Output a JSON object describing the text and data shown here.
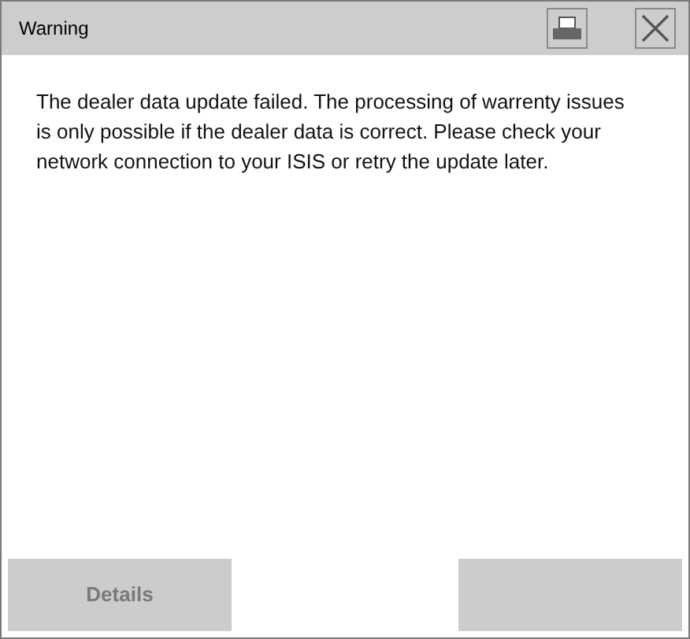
{
  "window": {
    "title": "Warning"
  },
  "message": "The dealer data update failed. The processing of warrenty issues is only possible if the dealer data is correct. Please check your network connection to your ISIS or retry the update later.",
  "buttons": [
    {
      "label": "Details",
      "disabled": true
    }
  ]
}
